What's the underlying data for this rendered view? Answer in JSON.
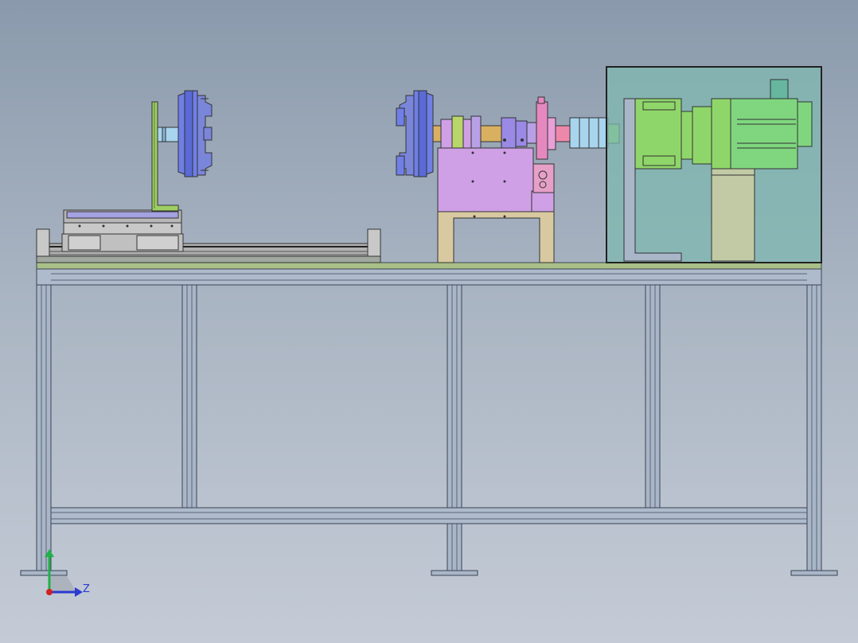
{
  "viewport": {
    "background_top": "#8a9aac",
    "background_bottom": "#c4cbd6"
  },
  "triad": {
    "z_label": "Z",
    "y_axis_color": "#22b04a",
    "z_axis_color": "#2b3ad0",
    "origin_color": "#d02020"
  },
  "model": {
    "frame_color": "#a9b6c8",
    "plate_color": "#a9bf88",
    "chuck_color": "#6f7fe6",
    "bracket_color": "#9fcf63",
    "gearbox_color": "#8fd66a",
    "motor_color": "#7fd67f",
    "housing_color": "#cfa0e6",
    "stand_color": "#d8c9a0",
    "enclosure_color": "#7fb8b0",
    "coupling_color": "#a8d4ee",
    "flange_color": "#ee88aa"
  }
}
